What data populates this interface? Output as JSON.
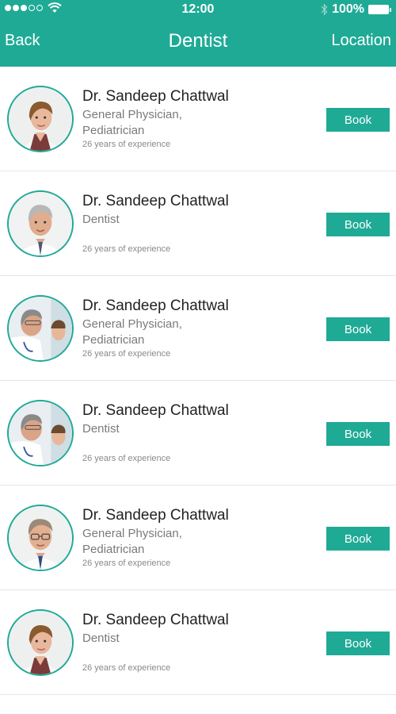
{
  "status_bar": {
    "time": "12:00",
    "battery": "100%",
    "signal_strength": "3 of 5 dots filled",
    "icons": [
      "signal-dots",
      "wifi-icon",
      "bluetooth-icon",
      "battery-icon"
    ]
  },
  "nav": {
    "back_label": "Back",
    "title": "Dentist",
    "location_label": "Location"
  },
  "colors": {
    "accent": "#1faa96",
    "name_text": "#222222",
    "secondary_text": "#7a7a7a",
    "divider": "#e6e6e6"
  },
  "doctors": [
    {
      "name": "Dr. Sandeep Chattwal",
      "specialty": "General Physician,\nPediatrician",
      "experience": "26 years of experience",
      "book_label": "Book",
      "avatar_icon": "female-doctor-photo"
    },
    {
      "name": "Dr. Sandeep Chattwal",
      "specialty": "Dentist",
      "experience": "26 years of experience",
      "book_label": "Book",
      "avatar_icon": "male-doctor-photo"
    },
    {
      "name": "Dr. Sandeep Chattwal",
      "specialty": "General Physician,\nPediatrician",
      "experience": "26 years of experience",
      "book_label": "Book",
      "avatar_icon": "doctor-with-patient-photo"
    },
    {
      "name": "Dr. Sandeep Chattwal",
      "specialty": "Dentist",
      "experience": "26 years of experience",
      "book_label": "Book",
      "avatar_icon": "doctor-with-patient-photo"
    },
    {
      "name": "Dr. Sandeep Chattwal",
      "specialty": "General Physician,\nPediatrician",
      "experience": "26 years of experience",
      "book_label": "Book",
      "avatar_icon": "male-doctor-glasses-photo"
    },
    {
      "name": "Dr. Sandeep Chattwal",
      "specialty": "Dentist",
      "experience": "26 years of experience",
      "book_label": "Book",
      "avatar_icon": "female-doctor-photo"
    }
  ]
}
